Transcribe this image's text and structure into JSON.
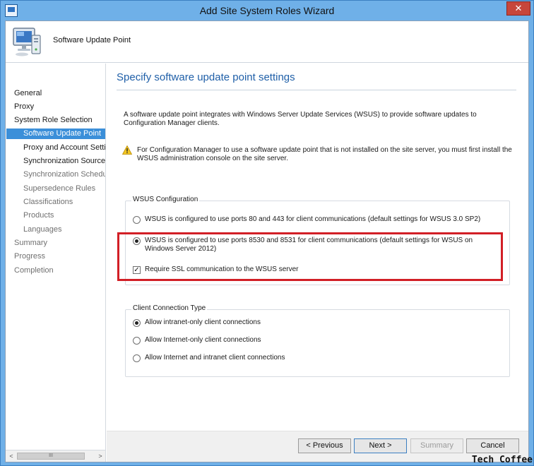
{
  "window": {
    "title": "Add Site System Roles Wizard",
    "close_glyph": "✕"
  },
  "header": {
    "title": "Software Update Point"
  },
  "nav": {
    "items": [
      {
        "label": "General",
        "state": "normal"
      },
      {
        "label": "Proxy",
        "state": "normal"
      },
      {
        "label": "System Role Selection",
        "state": "normal"
      },
      {
        "label": "Software Update Point",
        "state": "active"
      },
      {
        "label": "Proxy and Account Settings",
        "state": "normal"
      },
      {
        "label": "Synchronization Source",
        "state": "normal"
      },
      {
        "label": "Synchronization Schedule",
        "state": "dim"
      },
      {
        "label": "Supersedence Rules",
        "state": "dim"
      },
      {
        "label": "Classifications",
        "state": "dim"
      },
      {
        "label": "Products",
        "state": "dim"
      },
      {
        "label": "Languages",
        "state": "dim"
      },
      {
        "label": "Summary",
        "state": "dim"
      },
      {
        "label": "Progress",
        "state": "dim"
      },
      {
        "label": "Completion",
        "state": "dim"
      }
    ],
    "scroll_thumb": "III",
    "scroll_left": "<",
    "scroll_right": ">"
  },
  "content": {
    "page_title": "Specify software update point settings",
    "intro": "A software update point integrates with Windows Server Update Services (WSUS) to provide software updates to Configuration Manager clients.",
    "warning": "For Configuration Manager to use a software update point that is not installed on the site server, you must first install the WSUS administration console on the site server.",
    "wsus_group": {
      "label": "WSUS Configuration",
      "option_80": "WSUS is configured to use ports 80 and 443 for client communications (default settings for WSUS 3.0 SP2)",
      "option_8530": "WSUS is configured to use ports 8530 and 8531 for client communications (default settings for WSUS on Windows Server 2012)",
      "selected": "option_8530",
      "require_ssl": "Require SSL communication to the WSUS server",
      "require_ssl_checked": true
    },
    "client_group": {
      "label": "Client Connection Type",
      "option_intranet": "Allow intranet-only client connections",
      "option_internet": "Allow Internet-only client connections",
      "option_both": "Allow Internet and intranet client connections",
      "selected": "option_intranet"
    }
  },
  "footer": {
    "previous": "< Previous",
    "next": "Next >",
    "summary": "Summary",
    "cancel": "Cancel"
  },
  "watermark": "Tech Coffee",
  "colors": {
    "accent": "#3b8fd9",
    "title_blue": "#1f5fa8",
    "highlight_red": "#d21f26",
    "frame": "#6fb0e8"
  }
}
